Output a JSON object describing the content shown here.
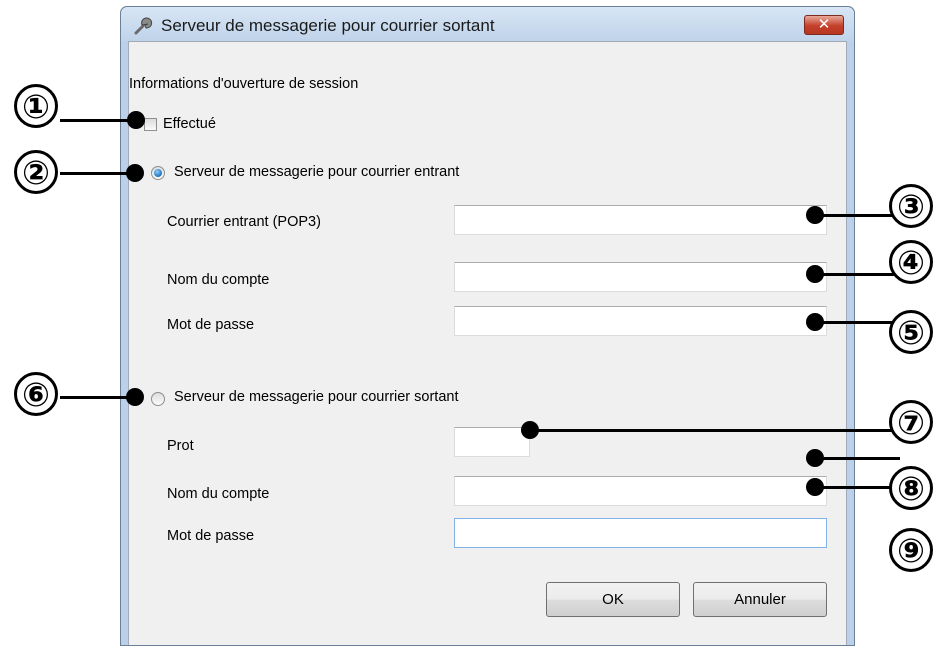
{
  "window": {
    "title": "Serveur de messagerie pour courrier sortant",
    "close_label": "✕"
  },
  "form": {
    "section_label": "Informations d'ouverture de session",
    "checkbox_label": "Effectué",
    "incoming": {
      "radio_label": "Serveur de messagerie pour courrier entrant",
      "selected": true,
      "server_label": "Courrier entrant (POP3)",
      "server_value": "",
      "account_label": "Nom du compte",
      "account_value": "",
      "password_label": "Mot de passe",
      "password_value": ""
    },
    "outgoing": {
      "radio_label": "Serveur de messagerie pour courrier sortant",
      "selected": false,
      "port_label": "Prot",
      "port_value": "",
      "account_label": "Nom du compte",
      "account_value": "",
      "password_label": "Mot de passe",
      "password_value": ""
    }
  },
  "buttons": {
    "ok": "OK",
    "cancel": "Annuler"
  },
  "callouts": [
    "①",
    "②",
    "③",
    "④",
    "⑤",
    "⑥",
    "⑦",
    "⑧",
    "⑨"
  ],
  "icons": {
    "app": "wrench-icon",
    "close": "close-icon"
  }
}
